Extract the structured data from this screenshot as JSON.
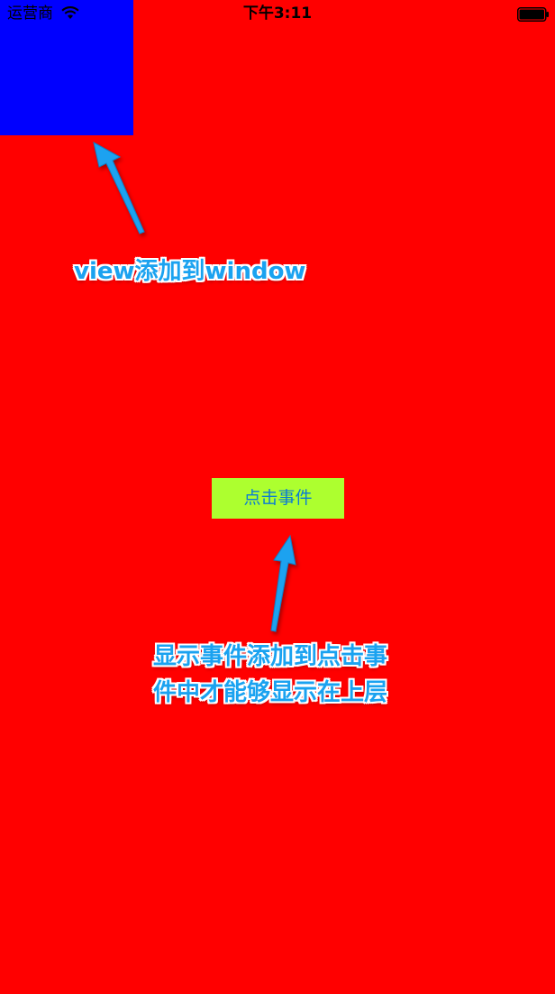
{
  "status_bar": {
    "carrier": "运营商",
    "time": "下午3:11",
    "wifi_icon": "wifi-icon",
    "battery_icon": "battery-icon"
  },
  "views": {
    "blue_view_color": "#0000ff",
    "background_color": "#ff0000"
  },
  "button": {
    "label": "点击事件",
    "background_color": "#adff2f",
    "text_color": "#0a7ad6"
  },
  "annotations": {
    "view_label": "view添加到window",
    "event_label_line1": "显示事件添加到点击事",
    "event_label_line2": "件中才能够显示在上层",
    "color": "#1aa2f0"
  }
}
